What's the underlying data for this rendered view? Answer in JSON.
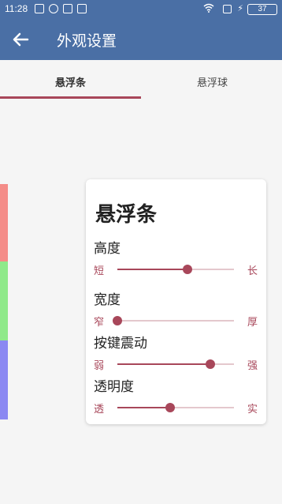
{
  "status_bar": {
    "time": "11:28",
    "battery": "37",
    "icons": [
      "notification-icon",
      "sync-icon",
      "mail-icon",
      "message-icon",
      "wifi-icon",
      "sim-icon",
      "charging-icon",
      "battery-icon"
    ]
  },
  "app_bar": {
    "title": "外观设置",
    "back_icon": "arrow-left-icon"
  },
  "tabs": [
    {
      "label": "悬浮条",
      "selected": true
    },
    {
      "label": "悬浮球",
      "selected": false
    }
  ],
  "colors": {
    "app_bar": "#4a6fa5",
    "accent": "#a8475a",
    "color_strips": [
      "#f48c88",
      "#8fe98a",
      "#8b88f2"
    ]
  },
  "card": {
    "title": "悬浮条",
    "settings": [
      {
        "label": "高度",
        "min_label": "短",
        "max_label": "长",
        "value": 0.6
      },
      {
        "label": "宽度",
        "min_label": "窄",
        "max_label": "厚",
        "value": 0.0
      },
      {
        "label": "按键震动",
        "min_label": "弱",
        "max_label": "强",
        "value": 0.8
      },
      {
        "label": "透明度",
        "min_label": "透",
        "max_label": "实",
        "value": 0.45
      }
    ]
  }
}
